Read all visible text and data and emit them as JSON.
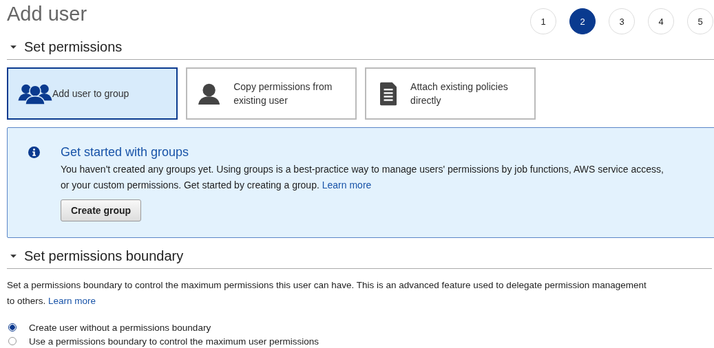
{
  "title": "Add user",
  "steps": [
    {
      "label": "1",
      "selected": false
    },
    {
      "label": "2",
      "selected": true
    },
    {
      "label": "3",
      "selected": false
    },
    {
      "label": "4",
      "selected": false
    },
    {
      "label": "5",
      "selected": false
    }
  ],
  "permissions": {
    "heading": "Set permissions",
    "expanded": true,
    "options": [
      {
        "kind": "group",
        "label": "Add user to group",
        "selected": true
      },
      {
        "kind": "user",
        "label": "Copy permissions from existing user",
        "selected": false
      },
      {
        "kind": "document",
        "label": "Attach existing policies directly",
        "selected": false
      }
    ],
    "info": {
      "title": "Get started with groups",
      "text": "You haven't created any groups yet. Using groups is a best-practice way to manage users' permissions by job functions, AWS service access, or your custom permissions. Get started by creating a group.",
      "link": "Learn more",
      "button": "Create group"
    }
  },
  "boundary": {
    "heading": "Set permissions boundary",
    "expanded": true,
    "text": "Set a permissions boundary to control the maximum permissions this user can have. This is an advanced feature used to delegate permission management to others.",
    "link": "Learn more",
    "choices": [
      {
        "label": "Create user without a permissions boundary",
        "selected": true
      },
      {
        "label": "Use a permissions boundary to control the maximum user permissions",
        "selected": false
      }
    ]
  }
}
